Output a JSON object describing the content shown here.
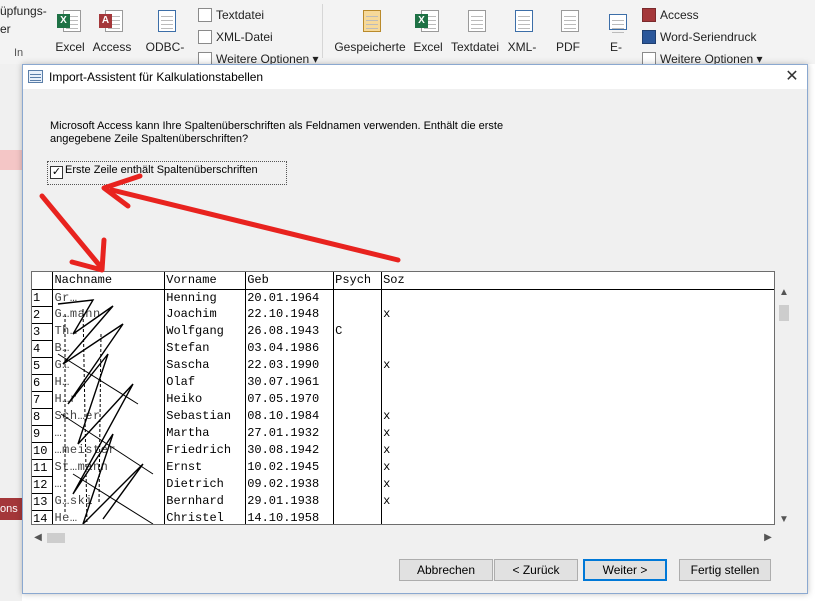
{
  "ribbon": {
    "left_group": {
      "label_top": "üpfungs-",
      "label_bottom": "er",
      "label_row3": "In"
    },
    "import_items": [
      {
        "label": "Excel",
        "icon": "excel-icon",
        "color": "#1e7145",
        "badge": "X"
      },
      {
        "label": "Access",
        "icon": "access-icon",
        "color": "#a4373a",
        "badge": "A"
      },
      {
        "label": "ODBC-",
        "icon": "odbc-icon",
        "color": "#3c6ea8",
        "badge": ""
      }
    ],
    "import_small": [
      {
        "label": "Textdatei",
        "icon": "text-file-icon"
      },
      {
        "label": "XML-Datei",
        "icon": "xml-file-icon"
      },
      {
        "label": "Weitere Optionen ▾",
        "icon": "more-options-icon"
      }
    ],
    "export_items": [
      {
        "label": "Gespeicherte",
        "icon": "saved-exports-icon",
        "color": "#d9a441",
        "badge": ""
      },
      {
        "label": "Excel",
        "icon": "excel-icon",
        "color": "#1e7145",
        "badge": "X"
      },
      {
        "label": "Textdatei",
        "icon": "text-file-icon",
        "color": "#6a6a6a",
        "badge": ""
      },
      {
        "label": "XML-",
        "icon": "xml-file-icon",
        "color": "#3c6ea8",
        "badge": ""
      },
      {
        "label": "PDF",
        "icon": "pdf-icon",
        "color": "#7a7a7a",
        "badge": ""
      },
      {
        "label": "E-",
        "icon": "email-icon",
        "color": "#3c6ea8",
        "badge": ""
      }
    ],
    "export_small": [
      {
        "label": "Access",
        "icon": "access-icon",
        "color": "#a4373a"
      },
      {
        "label": "Word-Seriendruck",
        "icon": "word-icon",
        "color": "#2b579a"
      },
      {
        "label": "Weitere Optionen ▾",
        "icon": "more-options-icon",
        "color": "#6a6a6a"
      }
    ]
  },
  "background": {
    "tab_label": "ons"
  },
  "dialog": {
    "title": "Import-Assistent für Kalkulationstabellen",
    "close_glyph": "✕",
    "description": "Microsoft Access kann Ihre Spaltenüberschriften als Feldnamen verwenden. Enthält die erste angegebene Zeile Spaltenüberschriften?",
    "checkbox_label": "Erste Zeile enthält Spaltenüberschriften",
    "checkbox_checked": true,
    "checkbox_glyph": "✓",
    "columns": [
      "Nachname",
      "Vorname",
      "Geb",
      "Psych",
      "Soz"
    ],
    "rows": [
      {
        "num": "1",
        "nachname": "Gr…",
        "vorname": "Henning",
        "geb": "20.01.1964",
        "psych": "",
        "soz": ""
      },
      {
        "num": "2",
        "nachname": "G…mann",
        "vorname": "Joachim",
        "geb": "22.10.1948",
        "psych": "",
        "soz": "x"
      },
      {
        "num": "3",
        "nachname": "Th…",
        "vorname": "Wolfgang",
        "geb": "26.08.1943",
        "psych": "C",
        "soz": ""
      },
      {
        "num": "4",
        "nachname": "B…",
        "vorname": "Stefan",
        "geb": "03.04.1986",
        "psych": "",
        "soz": ""
      },
      {
        "num": "5",
        "nachname": "G…",
        "vorname": "Sascha",
        "geb": "22.03.1990",
        "psych": "",
        "soz": "x"
      },
      {
        "num": "6",
        "nachname": "H…",
        "vorname": "Olaf",
        "geb": "30.07.1961",
        "psych": "",
        "soz": ""
      },
      {
        "num": "7",
        "nachname": "H…r",
        "vorname": "Heiko",
        "geb": "07.05.1970",
        "psych": "",
        "soz": ""
      },
      {
        "num": "8",
        "nachname": "Sch…er",
        "vorname": "Sebastian",
        "geb": "08.10.1984",
        "psych": "",
        "soz": "x"
      },
      {
        "num": "9",
        "nachname": "…",
        "vorname": "Martha",
        "geb": "27.01.1932",
        "psych": "",
        "soz": "x"
      },
      {
        "num": "10",
        "nachname": "…meister",
        "vorname": "Friedrich",
        "geb": "30.08.1942",
        "psych": "",
        "soz": "x"
      },
      {
        "num": "11",
        "nachname": "St…mann",
        "vorname": "Ernst",
        "geb": "10.02.1945",
        "psych": "",
        "soz": "x"
      },
      {
        "num": "12",
        "nachname": "…",
        "vorname": "Dietrich",
        "geb": "09.02.1938",
        "psych": "",
        "soz": "x"
      },
      {
        "num": "13",
        "nachname": "G…ski",
        "vorname": "Bernhard",
        "geb": "29.01.1938",
        "psych": "",
        "soz": "x"
      },
      {
        "num": "14",
        "nachname": "He…",
        "vorname": "Christel",
        "geb": "14.10.1958",
        "psych": "",
        "soz": ""
      }
    ],
    "buttons": {
      "cancel": "Abbrechen",
      "back": "< Zurück",
      "next": "Weiter >",
      "finish": "Fertig stellen"
    }
  },
  "annotation": {
    "color": "#e8231f"
  }
}
